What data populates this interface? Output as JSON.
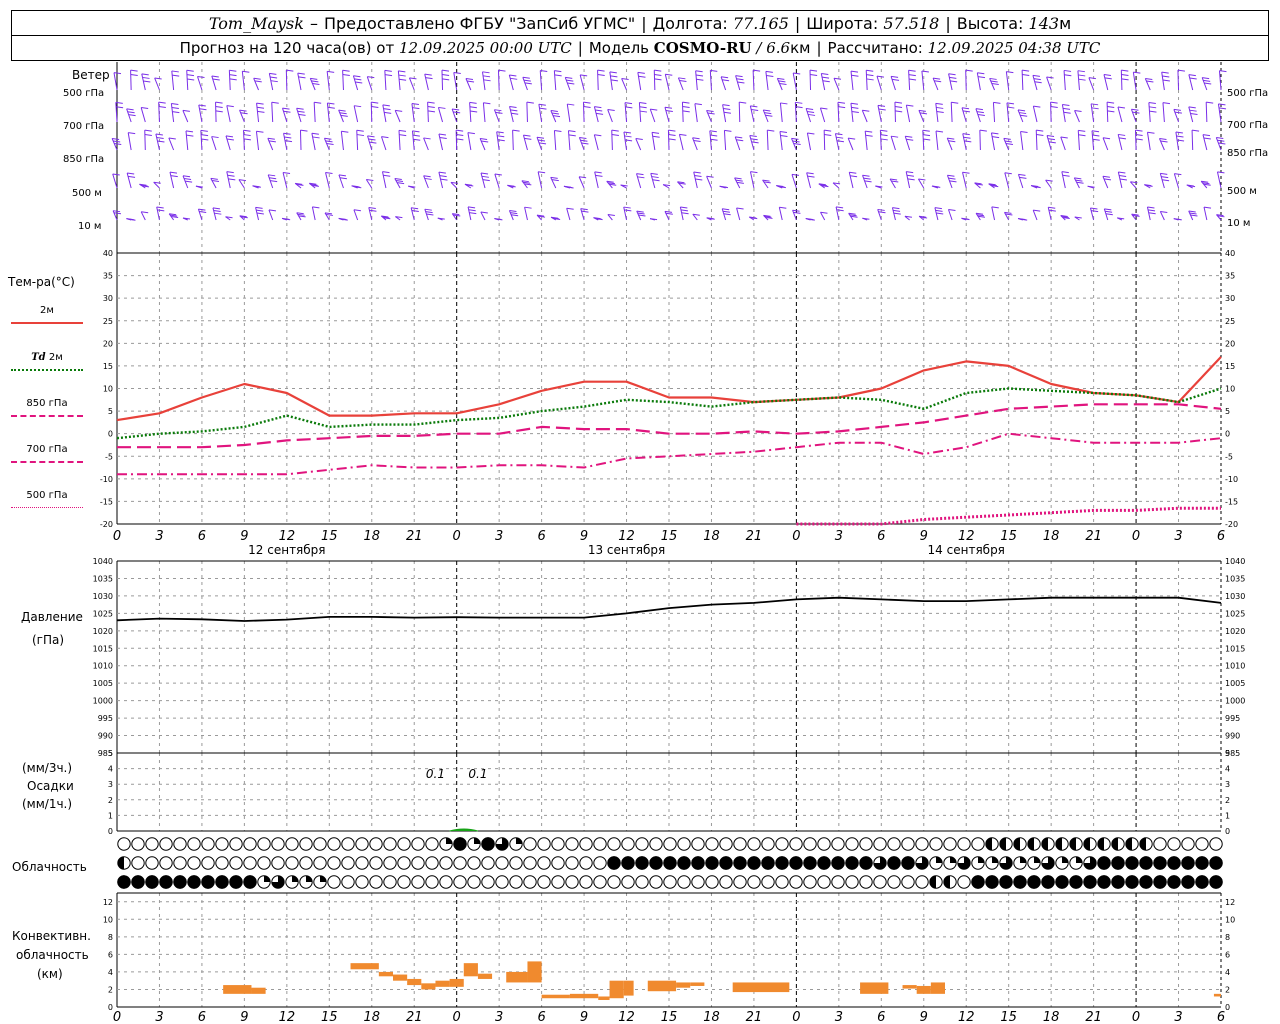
{
  "header": {
    "station": "Tom_Maysk",
    "provided": "Предоставлено ФГБУ \"ЗапСиб УГМС\"",
    "lon_label": "Долгота:",
    "lon": "77.165",
    "lat_label": "Широта:",
    "lat": "57.518",
    "alt_label": "Высота:",
    "alt": "143",
    "alt_unit": "м",
    "forecast_label": "Прогноз на 120 часа(ов) от",
    "forecast_from": "12.09.2025 00:00 UTC",
    "model_label": "Модель",
    "model": "COSMO-RU",
    "model_res": "/ 6.6",
    "model_res_unit": "км",
    "calc_label": "Рассчитано:",
    "calc_time": "12.09.2025 04:38 UTC"
  },
  "labels": {
    "wind": "Ветер",
    "wind_levels": [
      "500 гПа",
      "700 гПа",
      "850 гПа",
      "500 м",
      "10  м"
    ],
    "temp_title": "Тем-ра(°C)",
    "legend_2m": "2м",
    "legend_td": "Td",
    "legend_td_2m": "2м",
    "legend_850": "850 гПа",
    "legend_700": "700 гПа",
    "legend_500": "500 гПа",
    "pressure_title": "Давление",
    "pressure_unit": "(гПа)",
    "precip_unit1": "(мм/3ч.)",
    "precip_title": "Осадки",
    "precip_unit2": "(мм/1ч.)",
    "cloud_title": "Облачность",
    "conv_title1": "Конвективн.",
    "conv_title2": "облачность",
    "conv_unit": "(км)"
  },
  "colors": {
    "t2m": "#e8413a",
    "td": "#0a7a0a",
    "t850": "#e0147e",
    "t700": "#e0147e",
    "t500": "#e0147e",
    "wind": "#7a2ee8",
    "pressure": "#000000",
    "conv": "#f08a2e",
    "precip": "#17a317"
  },
  "chart_data": [
    {
      "type": "line",
      "name": "temperature",
      "x_ticks": [
        "0",
        "3",
        "6",
        "9",
        "12",
        "15",
        "18",
        "21",
        "0",
        "3",
        "6",
        "9",
        "12",
        "15",
        "18",
        "21",
        "0",
        "3",
        "6",
        "9",
        "12",
        "15",
        "18",
        "21",
        "0",
        "3",
        "6"
      ],
      "day_labels": [
        "12 сентября",
        "13 сентября",
        "14 сентября"
      ],
      "xlim": [
        0,
        78
      ],
      "ylim": [
        -20,
        40
      ],
      "y_ticks": [
        -20,
        -15,
        -10,
        -5,
        0,
        5,
        10,
        15,
        20,
        25,
        30,
        35,
        40
      ],
      "series": [
        {
          "name": "2м",
          "x": [
            0,
            3,
            6,
            9,
            12,
            15,
            18,
            21,
            24,
            27,
            30,
            33,
            36,
            39,
            42,
            45,
            48,
            51,
            54,
            57,
            60,
            63,
            66,
            69,
            72,
            75,
            78
          ],
          "y": [
            3,
            4.5,
            8,
            11,
            9,
            4,
            4,
            4.5,
            4.5,
            6.5,
            9.5,
            11.5,
            11.5,
            8,
            8,
            7,
            7.5,
            8,
            10,
            14,
            16,
            15,
            11,
            9,
            8.5,
            7,
            17
          ]
        },
        {
          "name": "Td 2м",
          "x": [
            0,
            3,
            6,
            9,
            12,
            15,
            18,
            21,
            24,
            27,
            30,
            33,
            36,
            39,
            42,
            45,
            48,
            51,
            54,
            57,
            60,
            63,
            66,
            69,
            72,
            75,
            78
          ],
          "y": [
            -1,
            0,
            0.5,
            1.5,
            4,
            1.5,
            2,
            2,
            3,
            3.5,
            5,
            6,
            7.5,
            7,
            6,
            7,
            7.5,
            8,
            7.5,
            5.5,
            9,
            10,
            9.5,
            9,
            8.5,
            7,
            10
          ]
        },
        {
          "name": "850 гПа",
          "x": [
            0,
            3,
            6,
            9,
            12,
            15,
            18,
            21,
            24,
            27,
            30,
            33,
            36,
            39,
            42,
            45,
            48,
            51,
            54,
            57,
            60,
            63,
            66,
            69,
            72,
            75,
            78
          ],
          "y": [
            -3,
            -3,
            -3,
            -2.5,
            -1.5,
            -1,
            -0.5,
            -0.5,
            0,
            0,
            1.5,
            1,
            1,
            0,
            0,
            0.5,
            0,
            0.5,
            1.5,
            2.5,
            4,
            5.5,
            6,
            6.5,
            6.5,
            6.5,
            5.5
          ]
        },
        {
          "name": "700 гПа",
          "x": [
            0,
            3,
            6,
            9,
            12,
            15,
            18,
            21,
            24,
            27,
            30,
            33,
            36,
            39,
            42,
            45,
            48,
            51,
            54,
            57,
            60,
            63,
            66,
            69,
            72,
            75,
            78
          ],
          "y": [
            -9,
            -9,
            -9,
            -9,
            -9,
            -8,
            -7,
            -7.5,
            -7.5,
            -7,
            -7,
            -7.5,
            -5.5,
            -5,
            -4.5,
            -4,
            -3,
            -2,
            -2,
            -4.5,
            -3,
            0,
            -1,
            -2,
            -2,
            -2,
            -1
          ]
        },
        {
          "name": "500 гПа",
          "x": [
            48,
            51,
            54,
            57,
            60,
            63,
            66,
            69,
            72,
            75,
            78
          ],
          "y": [
            -20,
            -20,
            -20,
            -19,
            -18.5,
            -18,
            -17.5,
            -17,
            -17,
            -16.5,
            -16.5
          ]
        }
      ]
    },
    {
      "type": "line",
      "name": "pressure",
      "ylim": [
        985,
        1040
      ],
      "y_ticks": [
        985,
        990,
        995,
        1000,
        1005,
        1010,
        1015,
        1020,
        1025,
        1030,
        1035,
        1040
      ],
      "series": [
        {
          "name": "pressure",
          "x": [
            0,
            3,
            6,
            9,
            12,
            15,
            18,
            21,
            24,
            27,
            30,
            33,
            36,
            39,
            42,
            45,
            48,
            51,
            54,
            57,
            60,
            63,
            66,
            69,
            72,
            75,
            78
          ],
          "y": [
            1023,
            1023.5,
            1023.3,
            1022.8,
            1023.2,
            1024,
            1024,
            1023.8,
            1023.9,
            1023.8,
            1023.8,
            1023.8,
            1025,
            1026.5,
            1027.5,
            1028,
            1029,
            1029.5,
            1029,
            1028.5,
            1028.5,
            1029,
            1029.5,
            1029.5,
            1029.5,
            1029.5,
            1028
          ]
        }
      ]
    },
    {
      "type": "bar",
      "name": "precipitation",
      "ylim": [
        0,
        5
      ],
      "y_ticks": [
        0,
        1,
        2,
        3,
        4,
        5
      ],
      "annotations": [
        {
          "x": 22.5,
          "text": "0.1"
        },
        {
          "x": 25.5,
          "text": "0.1"
        }
      ]
    },
    {
      "type": "table",
      "name": "cloudiness",
      "rows": [
        "OOOOOOOOOOOOOOOOOOOOOOOQSQSRQOOOOOOOOOOOOOOOOOOOOOOOOOOOOOOOOOHHHHHHHHHHHHOOOOOOOOSQSRQSRQSRRRSRRSQRRSQRRQSRRRQRRRRRRRSQSQRSRRR",
        "HOOOOOOOOOOOOOOOOOOOOOOOOOOOOOOOOOOSSSSSSSSSSSSSSSSSSSRSSRQQRQQRQQRQQRSSSSSSSSSSSSHRQRRQRQRRQRRQRRQRRQRRQRRQRRQRRQRRQSSSS",
        "SSSSSSSSSSQRQQQOOOOOOOOOOOOOOOOOOOOOOOOOOOOOOOOOOOOOOOOOOOHHOSSSSSSSSSSSSSSSSSSSSSSHHOOOOOOOOOOOOOOOOOOOOOOSSSSSSSSSSOOOOOOOOOOO"
      ]
    },
    {
      "type": "bar",
      "name": "convective_cloud",
      "ylim": [
        0,
        13
      ],
      "y_ticks": [
        0,
        2,
        4,
        6,
        8,
        10,
        12
      ],
      "bars": [
        {
          "x0": 7.5,
          "x1": 9.5,
          "bottom": 1.5,
          "top": 2.5
        },
        {
          "x0": 9.5,
          "x1": 10.5,
          "bottom": 1.5,
          "top": 2.2
        },
        {
          "x0": 16.5,
          "x1": 18.5,
          "bottom": 4.3,
          "top": 5.0
        },
        {
          "x0": 18.5,
          "x1": 19.5,
          "bottom": 3.5,
          "top": 4.0
        },
        {
          "x0": 19.5,
          "x1": 20.5,
          "bottom": 3.0,
          "top": 3.7
        },
        {
          "x0": 20.5,
          "x1": 21.5,
          "bottom": 2.5,
          "top": 3.2
        },
        {
          "x0": 21.5,
          "x1": 22.5,
          "bottom": 2.0,
          "top": 2.7
        },
        {
          "x0": 22.5,
          "x1": 23.5,
          "bottom": 2.3,
          "top": 3.0
        },
        {
          "x0": 23.5,
          "x1": 24.5,
          "bottom": 2.3,
          "top": 3.2
        },
        {
          "x0": 24.5,
          "x1": 25.5,
          "bottom": 3.5,
          "top": 5.0
        },
        {
          "x0": 25.5,
          "x1": 26.5,
          "bottom": 3.2,
          "top": 3.8
        },
        {
          "x0": 27.5,
          "x1": 29.0,
          "bottom": 2.8,
          "top": 4.0
        },
        {
          "x0": 29.0,
          "x1": 30.0,
          "bottom": 2.8,
          "top": 5.2
        },
        {
          "x0": 30.0,
          "x1": 32.0,
          "bottom": 1.0,
          "top": 1.4
        },
        {
          "x0": 32.0,
          "x1": 34.0,
          "bottom": 1.0,
          "top": 1.5
        },
        {
          "x0": 34.0,
          "x1": 34.8,
          "bottom": 0.8,
          "top": 1.2
        },
        {
          "x0": 34.8,
          "x1": 35.8,
          "bottom": 1.0,
          "top": 3.0
        },
        {
          "x0": 35.8,
          "x1": 36.5,
          "bottom": 1.3,
          "top": 3.0
        },
        {
          "x0": 37.5,
          "x1": 39.5,
          "bottom": 1.8,
          "top": 3.0
        },
        {
          "x0": 39.5,
          "x1": 40.5,
          "bottom": 2.2,
          "top": 2.8
        },
        {
          "x0": 40.5,
          "x1": 41.5,
          "bottom": 2.4,
          "top": 2.8
        },
        {
          "x0": 43.5,
          "x1": 47.5,
          "bottom": 1.7,
          "top": 2.8
        },
        {
          "x0": 52.5,
          "x1": 54.5,
          "bottom": 1.5,
          "top": 2.8
        },
        {
          "x0": 55.5,
          "x1": 56.5,
          "bottom": 2.1,
          "top": 2.5
        },
        {
          "x0": 56.5,
          "x1": 57.5,
          "bottom": 1.5,
          "top": 2.4
        },
        {
          "x0": 57.5,
          "x1": 58.5,
          "bottom": 1.5,
          "top": 2.8
        },
        {
          "x0": 77.5,
          "x1": 78.0,
          "bottom": 1.2,
          "top": 1.5
        }
      ]
    }
  ]
}
